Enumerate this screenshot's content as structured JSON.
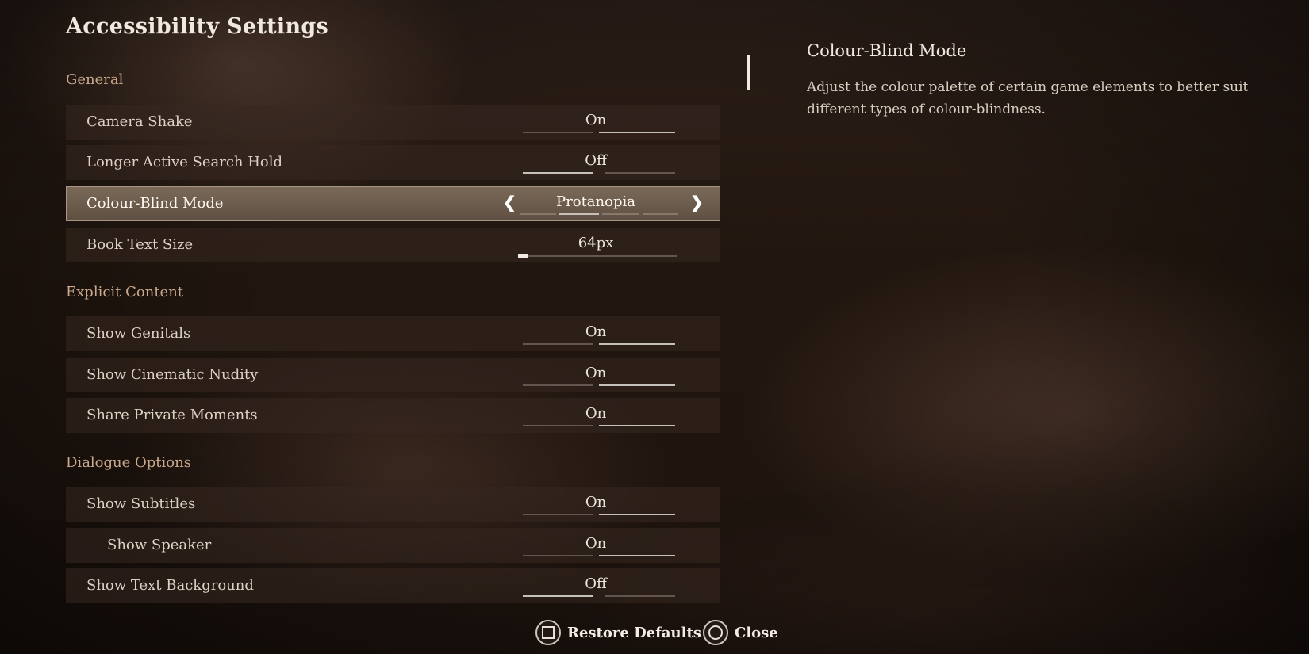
{
  "title": "Accessibility Settings",
  "sections": {
    "general": "General",
    "explicit": "Explicit Content",
    "dialogue": "Dialogue Options"
  },
  "rows": {
    "camera_shake": {
      "label": "Camera Shake",
      "value": "On"
    },
    "longer_search": {
      "label": "Longer Active Search Hold",
      "value": "Off"
    },
    "colour_blind": {
      "label": "Colour-Blind Mode",
      "value": "Protanopia"
    },
    "book_text": {
      "label": "Book Text Size",
      "value": "64px",
      "level": 0.06
    },
    "genitals": {
      "label": "Show Genitals",
      "value": "On"
    },
    "cinematic": {
      "label": "Show Cinematic Nudity",
      "value": "On"
    },
    "private": {
      "label": "Share Private Moments",
      "value": "On"
    },
    "subtitles": {
      "label": "Show Subtitles",
      "value": "On"
    },
    "speaker": {
      "label": "Show Speaker",
      "value": "On"
    },
    "text_bg": {
      "label": "Show Text Background",
      "value": "Off"
    }
  },
  "description": {
    "title": "Colour-Blind Mode",
    "text": "Adjust the colour palette of certain game elements to better suit different types of colour-blindness."
  },
  "footer": {
    "restore": "Restore Defaults",
    "close": "Close"
  },
  "icons": {
    "left": "chevron-left-icon",
    "right": "chevron-right-icon",
    "square_button": "square-button-icon",
    "circle_button": "circle-button-icon"
  }
}
